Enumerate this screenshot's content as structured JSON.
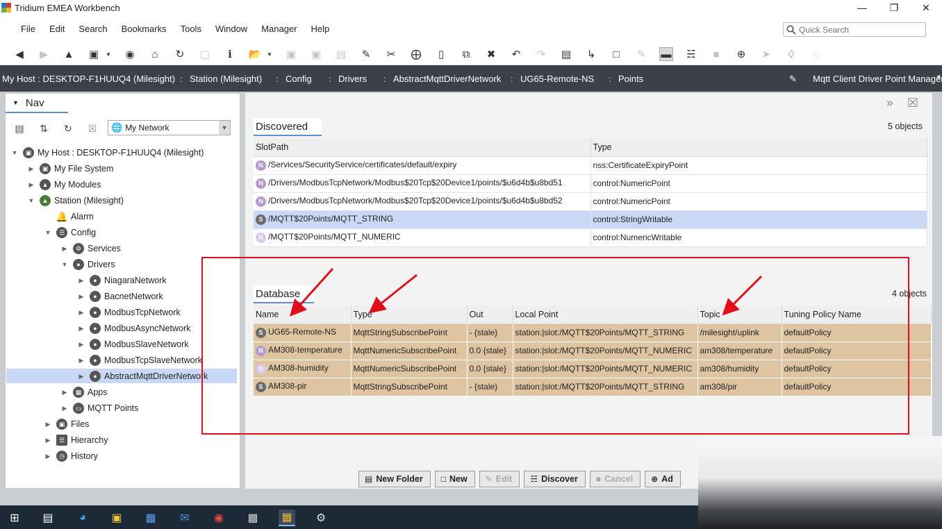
{
  "window": {
    "title": "Tridium EMEA Workbench"
  },
  "menu": [
    "File",
    "Edit",
    "Search",
    "Bookmarks",
    "Tools",
    "Window",
    "Manager",
    "Help"
  ],
  "quicksearch": {
    "placeholder": "Quick Search"
  },
  "breadcrumb": {
    "items": [
      "My Host : DESKTOP-F1HUUQ4 (Milesight)",
      "Station (Milesight)",
      "Config",
      "Drivers",
      "AbstractMqttDriverNetwork",
      "UG65-Remote-NS",
      "Points"
    ],
    "view": "Mqtt Client Driver Point Manager"
  },
  "nav": {
    "title": "Nav",
    "network_select": "My Network",
    "tree": [
      {
        "label": "My Host : DESKTOP-F1HUUQ4 (Milesight)",
        "icon": "host-icon",
        "expanded": true
      },
      {
        "label": "My File System",
        "icon": "file-system-icon",
        "expanded": false
      },
      {
        "label": "My Modules",
        "icon": "modules-icon",
        "expanded": false
      },
      {
        "label": "Station (Milesight)",
        "icon": "station-icon",
        "expanded": true
      },
      {
        "label": "Alarm",
        "icon": "bell-icon",
        "expanded": null
      },
      {
        "label": "Config",
        "icon": "config-icon",
        "expanded": true
      },
      {
        "label": "Services",
        "icon": "services-icon",
        "expanded": false
      },
      {
        "label": "Drivers",
        "icon": "drivers-icon",
        "expanded": true
      },
      {
        "label": "NiagaraNetwork",
        "icon": "network-icon",
        "expanded": false
      },
      {
        "label": "BacnetNetwork",
        "icon": "network-icon",
        "expanded": false
      },
      {
        "label": "ModbusTcpNetwork",
        "icon": "network-icon",
        "expanded": false
      },
      {
        "label": "ModbusAsyncNetwork",
        "icon": "network-icon",
        "expanded": false
      },
      {
        "label": "ModbusSlaveNetwork",
        "icon": "network-icon",
        "expanded": false
      },
      {
        "label": "ModbusTcpSlaveNetwork",
        "icon": "network-icon",
        "expanded": false
      },
      {
        "label": "AbstractMqttDriverNetwork",
        "icon": "network-icon",
        "expanded": false,
        "selected": true
      },
      {
        "label": "Apps",
        "icon": "apps-icon",
        "expanded": false
      },
      {
        "label": "MQTT Points",
        "icon": "folder-icon",
        "expanded": false
      },
      {
        "label": "Files",
        "icon": "files-icon",
        "expanded": false
      },
      {
        "label": "Hierarchy",
        "icon": "hierarchy-icon",
        "expanded": false
      },
      {
        "label": "History",
        "icon": "history-icon",
        "expanded": false
      }
    ]
  },
  "discovered": {
    "title": "Discovered",
    "count": "5 objects",
    "columns": [
      "SlotPath",
      "Type"
    ],
    "rows": [
      {
        "badge": "N",
        "slot_path": "/Services/SecurityService/certificates/default/expiry",
        "type": "nss:CertificateExpiryPoint"
      },
      {
        "badge": "N",
        "slot_path": "/Drivers/ModbusTcpNetwork/Modbus$20Tcp$20Device1/points/$u6d4b$u8bd51",
        "type": "control:NumericPoint"
      },
      {
        "badge": "N",
        "slot_path": "/Drivers/ModbusTcpNetwork/Modbus$20Tcp$20Device1/points/$u6d4b$u8bd52",
        "type": "control:NumericPoint"
      },
      {
        "badge": "S",
        "slot_path": "/MQTT$20Points/MQTT_STRING",
        "type": "control:StringWritable",
        "selected": true
      },
      {
        "badge": "N",
        "slot_path": "/MQTT$20Points/MQTT_NUMERIC",
        "type": "control:NumericWritable"
      }
    ]
  },
  "database": {
    "title": "Database",
    "count": "4 objects",
    "columns": [
      "Name",
      "Type",
      "Out",
      "Local Point",
      "Topic",
      "Tuning Policy Name"
    ],
    "rows": [
      {
        "badge": "S",
        "name": "UG65-Remote-NS",
        "type": "MqttStringSubscribePoint",
        "out": "- {stale}",
        "local_point": "station:|slot:/MQTT$20Points/MQTT_STRING",
        "topic": "/milesight/uplink",
        "tuning": "defaultPolicy"
      },
      {
        "badge": "N",
        "name": "AM308-temperature",
        "type": "MqttNumericSubscribePoint",
        "out": "0.0 {stale}",
        "local_point": "station:|slot:/MQTT$20Points/MQTT_NUMERIC",
        "topic": "am308/temperature",
        "tuning": "defaultPolicy"
      },
      {
        "badge": "N",
        "name": "AM308-humidity",
        "type": "MqttNumericSubscribePoint",
        "out": "0.0 {stale}",
        "local_point": "station:|slot:/MQTT$20Points/MQTT_NUMERIC",
        "topic": "am308/humidity",
        "tuning": "defaultPolicy"
      },
      {
        "badge": "S",
        "name": "AM308-pir",
        "type": "MqttStringSubscribePoint",
        "out": "- {stale}",
        "local_point": "station:|slot:/MQTT$20Points/MQTT_STRING",
        "topic": "am308/pir",
        "tuning": "defaultPolicy"
      }
    ]
  },
  "buttons": {
    "new_folder": "New Folder",
    "new": "New",
    "edit": "Edit",
    "discover": "Discover",
    "cancel": "Cancel",
    "add_partial": "Ad"
  },
  "colors": {
    "annotation": "#e00d1b",
    "database_row": "#dec4a0",
    "selection": "#c9d9f5",
    "breadcrumb_bg": "#3b4049"
  }
}
